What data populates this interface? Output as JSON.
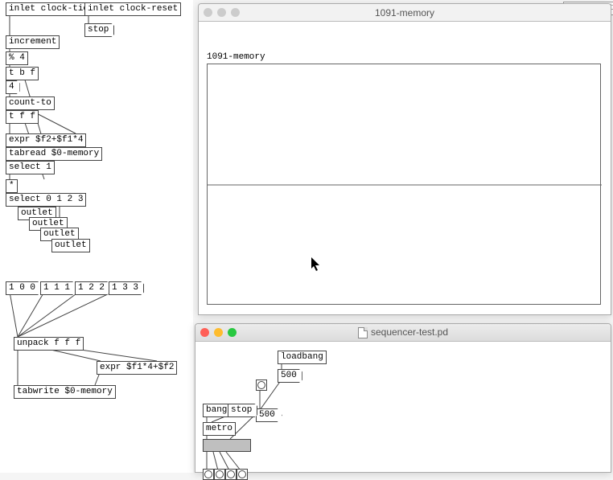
{
  "patch": {
    "objects": {
      "inlet_tick": "inlet clock-tick",
      "inlet_reset": "inlet clock-reset",
      "stop": "stop",
      "increment": "increment",
      "mod4": "% 4",
      "tbf1": "t b f",
      "four": "4",
      "count_to": "count-to",
      "tff": "t f f",
      "expr1": "expr $f2+$f1*4",
      "tabread": "tabread $0-memory",
      "select1": "select 1",
      "star": "*",
      "select0123": "select 0 1 2 3",
      "outlet1": "outlet",
      "outlet2": "outlet",
      "outlet3": "outlet",
      "outlet4": "outlet",
      "m100": "1 0 0",
      "m111": "1 1 1",
      "m122": "1 2 2",
      "m133": "1 3 3",
      "unpack": "unpack f f f",
      "expr2": "expr $f1*4+$f2",
      "tabwrite": "tabwrite $0-memory"
    }
  },
  "memory_window": {
    "title": "1091-memory",
    "array_label": "1091-memory"
  },
  "seq_window": {
    "title": "sequencer-test.pd",
    "loadbang": "loadbang",
    "num500a": "500",
    "num500b": "500",
    "bang": "bang",
    "stop": "stop",
    "metro": "metro"
  },
  "corner_fragment": "increment"
}
